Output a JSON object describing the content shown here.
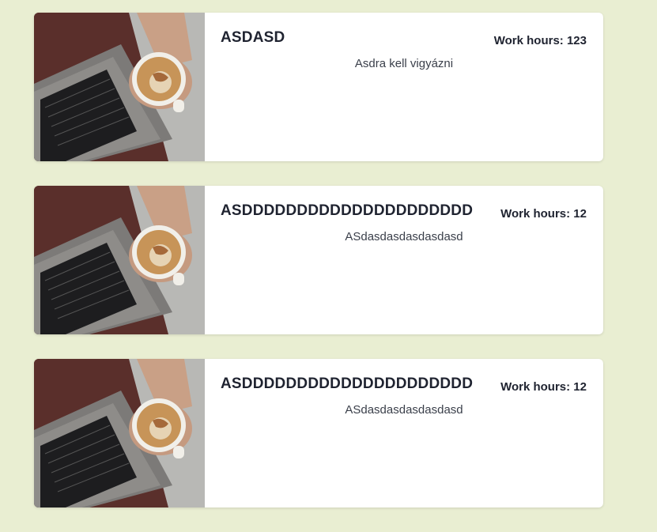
{
  "colors": {
    "page_background": "#e9eed2",
    "card_background": "#ffffff",
    "text_primary": "#1f2330"
  },
  "cards": [
    {
      "title": "ASDASD",
      "hours_label": "Work hours: 123",
      "description": "Asdra kell vigyázni",
      "image": "laptop-coffee-photo"
    },
    {
      "title": "ASDDDDDDDDDDDDDDDDDDDDD",
      "hours_label": "Work hours: 12",
      "description": "ASdasdasdasdasdasd",
      "image": "laptop-coffee-photo"
    },
    {
      "title": "ASDDDDDDDDDDDDDDDDDDDDD",
      "hours_label": "Work hours: 12",
      "description": "ASdasdasdasdasdasd",
      "image": "laptop-coffee-photo"
    }
  ]
}
